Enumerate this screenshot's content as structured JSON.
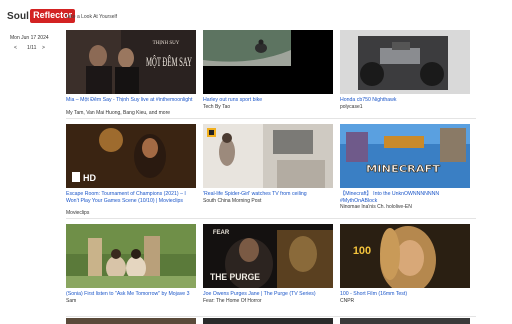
{
  "app": {
    "logo_soul": "Soul",
    "logo_reflector": "Reflector",
    "tagline": "Take a Look At Yourself"
  },
  "sidebar": {
    "date": "Mon Jun 17 2024",
    "prev_arrow": "<",
    "page": "1/11",
    "next_arrow": ">"
  },
  "videos": [
    {
      "title": "Mia – Một Đêm Say - Thịnh Suy live at #inthemoonlight",
      "channel": "My Tam, Van Mai Huong, Bang Kieu, and more",
      "thumb_text": "MỘT ĐÊM SAY",
      "thumb_text_small": "THỊNH SUY"
    },
    {
      "title": "Harley out runs sport bike",
      "channel": "Tech By Tao"
    },
    {
      "title": "Honda cb750 Nighthawk",
      "channel": "polycase1"
    },
    {
      "title": "Escape Room: Tournament of Champions (2021) – I Won't Play Your Games Scene (10/10) | Movieclips",
      "channel": "Movieclips",
      "thumb_text": "HD"
    },
    {
      "title": "'Real-life Spider-Girl' watches TV from ceiling",
      "channel": "South China Morning Post"
    },
    {
      "title": "【Minecraft】 Into the UnknOWNNNNNNN #MythOnABlock",
      "channel": "Ninomae Ina'nis Ch. hololive-EN",
      "thumb_text": "MINECRAFT"
    },
    {
      "title": "(Sonia) First listen to \"Ask Me Tomorrow\" by Mojave 3",
      "channel": "Sam"
    },
    {
      "title": "Joe Owens Purges Jane | The Purge (TV Series)",
      "channel": "Fear: The Home Of Horror",
      "thumb_text": "THE PURGE",
      "thumb_text_small": "FEAR"
    },
    {
      "title": "100 - Short Film (16mm Test)",
      "channel": "CNPR",
      "thumb_text": "100"
    }
  ]
}
